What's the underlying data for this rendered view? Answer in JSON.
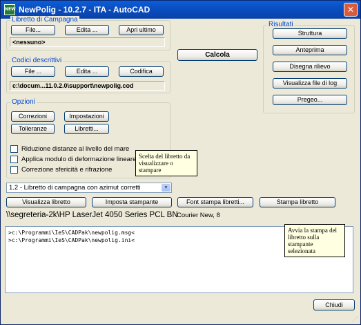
{
  "window": {
    "title": "NewPolig - 10.2.7 - ITA - AutoCAD",
    "icon_text": "NEW"
  },
  "libretto": {
    "legend": "Libretto di Campagna",
    "file_label": "File...",
    "edita_label": "Edita ...",
    "apri_label": "Apri ultimo",
    "current": "<nessuno>"
  },
  "codici": {
    "legend": "Codici descrittivi",
    "file_label": "File ...",
    "edita_label": "Edita ...",
    "codifica_label": "Codifica",
    "path": "c:\\docum...11.0.2.0\\support\\newpolig.cod"
  },
  "calcola_label": "Calcola",
  "risultati": {
    "legend": "Risultati",
    "items": [
      "Struttura",
      "Anteprima",
      "Disegna rilievo",
      "Visualizza file di log",
      "Pregeo..."
    ]
  },
  "opzioni": {
    "legend": "Opzioni",
    "correzioni": "Correzioni",
    "impostazioni": "Impostazioni",
    "tolleranze": "Tolleranze",
    "libretti": "Libretti...",
    "checks": [
      "Riduzione distanze al livello del mare",
      "Applica modulo di deformazione lineare di Gauss",
      "Correzione sfericità e rifrazione"
    ]
  },
  "tooltips": {
    "scelta": "Scelta del libretto da visualizzare o stampare",
    "avvia": "Avvia la stampa del libretto sulla stampante selezionata"
  },
  "libretto_select": {
    "value": "1.2 - Libretto di campagna con azimut corretti"
  },
  "print_buttons": {
    "visualizza": "Visualizza libretto",
    "imposta": "Imposta stampante",
    "font": "Font stampa libretti...",
    "stampa": "Stampa libretto"
  },
  "printer_name": "\\\\segreteria-2k\\HP LaserJet 4050 Series PCL BN",
  "font_name": "Courier New, 8",
  "log": [
    ">c:\\Programmi\\IeS\\CADPak\\newpolig.msg<",
    ">c:\\Programmi\\IeS\\CADPak\\newpolig.ini<"
  ],
  "chiudi_label": "Chiudi"
}
